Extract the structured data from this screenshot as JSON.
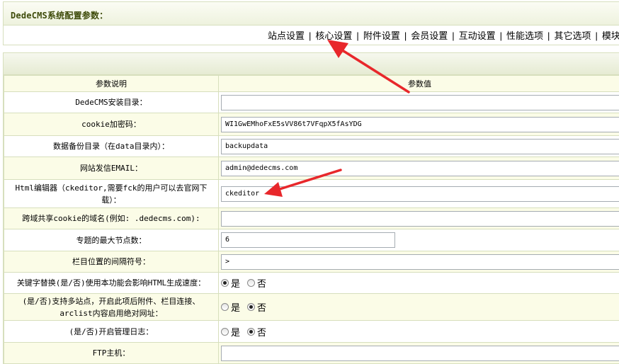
{
  "panel_title": "DedeCMS系统配置参数：",
  "tabs": [
    "站点设置",
    "核心设置",
    "附件设置",
    "会员设置",
    "互动设置",
    "性能选项",
    "其它选项",
    "模块设置"
  ],
  "table_header": {
    "desc": "参数说明",
    "value": "参数值"
  },
  "rows": [
    {
      "label": "DedeCMS安装目录：",
      "value": ""
    },
    {
      "label": "cookie加密码：",
      "value": "WI1GwEMhoFxE5sVV86t7VFqpX5fAsYDG"
    },
    {
      "label": "数据备份目录（在data目录内）：",
      "value": "backupdata"
    },
    {
      "label": "网站发信EMAIL：",
      "value": "admin@dedecms.com"
    },
    {
      "label": "Html编辑器（ckeditor,需要fck的用户可以去官网下载）：",
      "value": "ckeditor"
    },
    {
      "label": "跨域共享cookie的域名(例如: .dedecms.com):",
      "value": ""
    },
    {
      "label": "专题的最大节点数：",
      "value": "6"
    },
    {
      "label": "栏目位置的间隔符号：",
      "value": ">"
    },
    {
      "label": "关键字替换(是/否)使用本功能会影响HTML生成速度：",
      "yes": "是",
      "no": "否",
      "selected": "yes"
    },
    {
      "label": "(是/否)支持多站点，开启此项后附件、栏目连接、arclist内容启用绝对网址：",
      "yes": "是",
      "no": "否",
      "selected": "no"
    },
    {
      "label": "(是/否)开启管理日志：",
      "yes": "是",
      "no": "否",
      "selected": "no"
    },
    {
      "label": "FTP主机：",
      "value": ""
    }
  ],
  "colors": {
    "border": "#d7dfbd",
    "title_text": "#3e4b0a",
    "row_alt": "#fbfce7",
    "arrow": "#e8272b"
  }
}
